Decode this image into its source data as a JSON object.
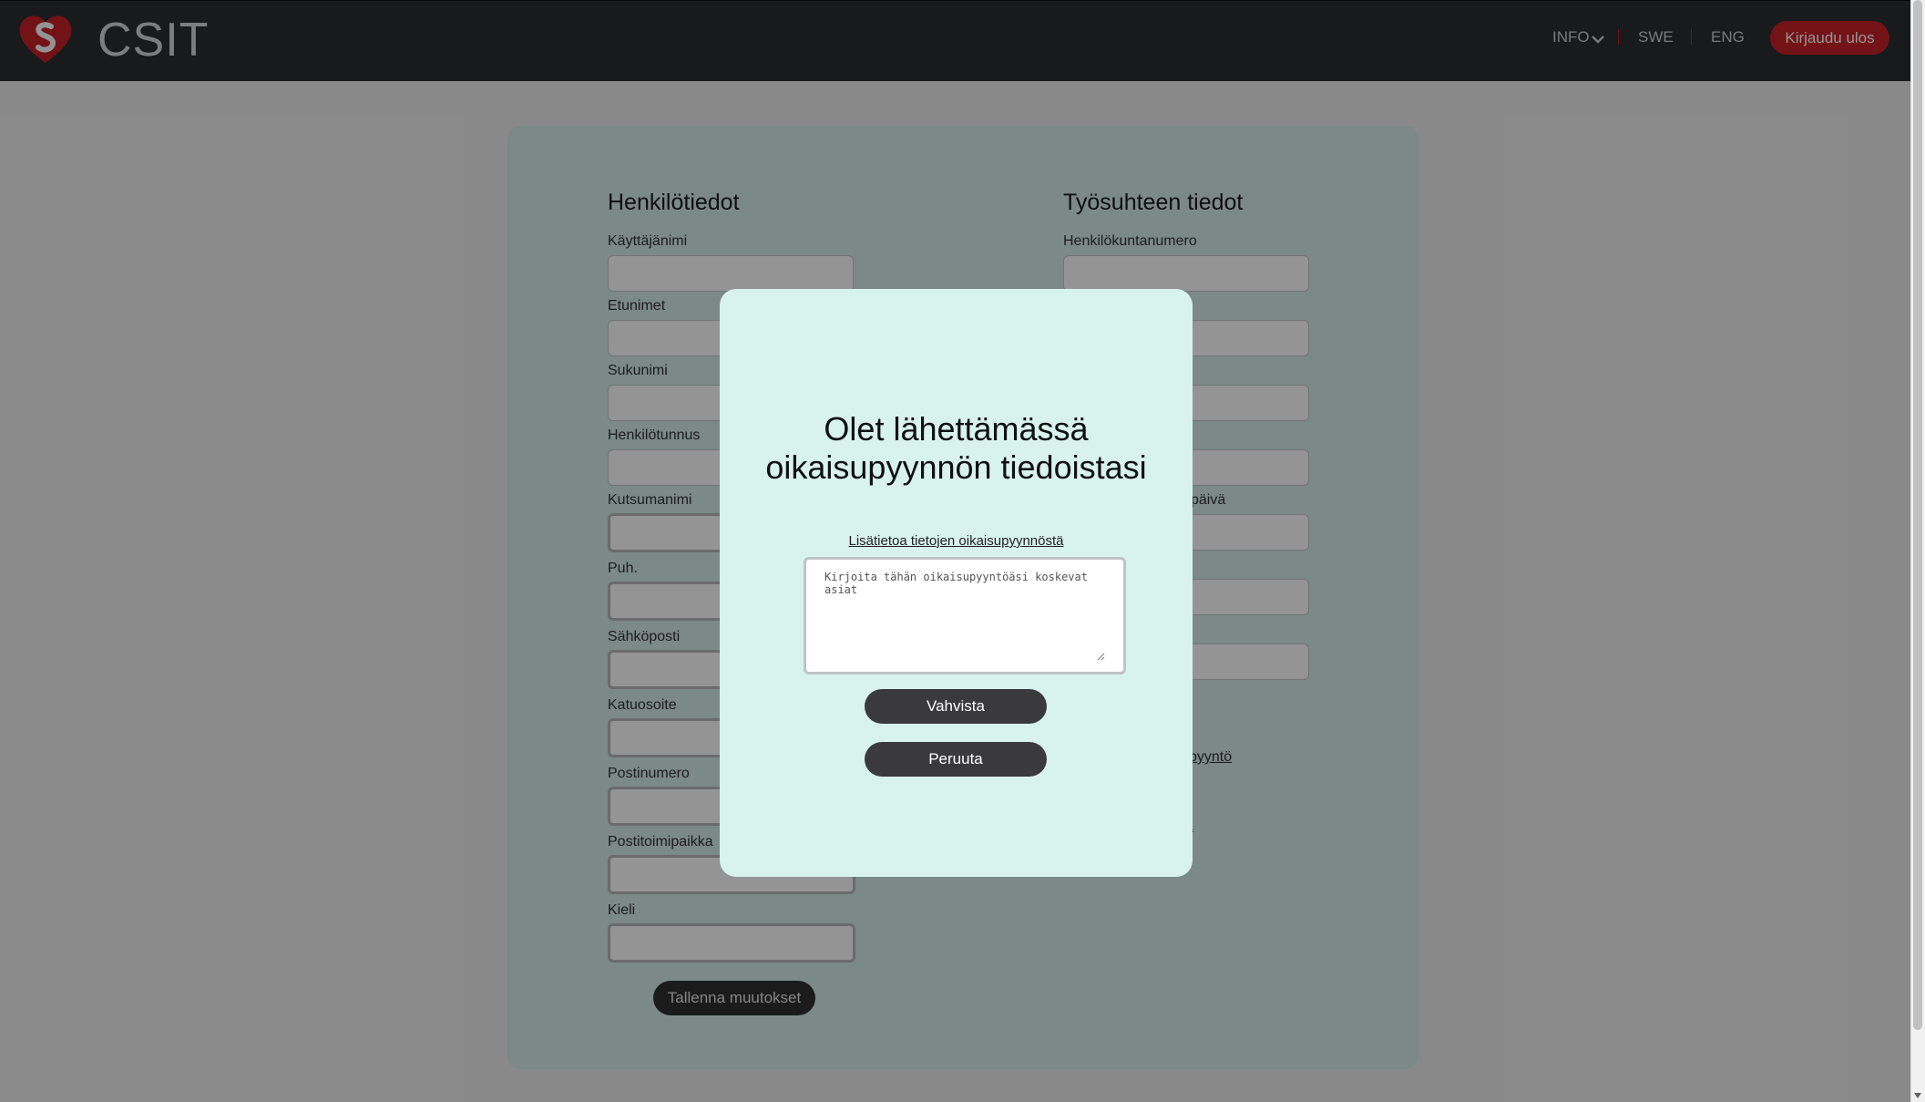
{
  "navbar": {
    "brand": "CSIT",
    "info_label": "INFO",
    "swe_label": "SWE",
    "eng_label": "ENG",
    "logout_label": "Kirjaudu ulos"
  },
  "personal": {
    "title": "Henkilötiedot",
    "fields": [
      {
        "label": "Käyttäjänimi",
        "value": ""
      },
      {
        "label": "Etunimet",
        "value": ""
      },
      {
        "label": "Sukunimi",
        "value": ""
      },
      {
        "label": "Henkilötunnus",
        "value": ""
      },
      {
        "label": "Kutsumanimi",
        "value": ""
      },
      {
        "label": "Puh.",
        "value": ""
      },
      {
        "label": "Sähköposti",
        "value": ""
      },
      {
        "label": "Katuosoite",
        "value": ""
      },
      {
        "label": "Postinumero",
        "value": ""
      },
      {
        "label": "Postitoimipaikka",
        "value": ""
      },
      {
        "label": "Kieli",
        "value": ""
      }
    ],
    "save_label": "Tallenna muutokset"
  },
  "employment": {
    "title": "Työsuhteen tiedot",
    "fields": [
      {
        "label": "Henkilökuntanumero",
        "value": ""
      }
    ],
    "partial_label_fragment": "päivä",
    "partial_link_1": "pyyntö",
    "partial_link_2": "ua"
  },
  "modal": {
    "title": "Olet lähettämässä oikaisupyynnön tiedoistasi",
    "info_link": "Lisätietoa tietojen oikaisupyynnöstä",
    "textarea_placeholder": "Kirjoita tähän oikaisupyyntöäsi koskevat asiat",
    "textarea_value": "",
    "confirm_label": "Vahvista",
    "cancel_label": "Peruuta"
  },
  "colors": {
    "accent": "#c62128",
    "navbar": "#2c2d30",
    "card": "#d5ece9",
    "modal": "#d8f2ee"
  },
  "icons": {
    "logo": "heart-logo-icon",
    "info_dropdown": "chevron-down-icon"
  }
}
